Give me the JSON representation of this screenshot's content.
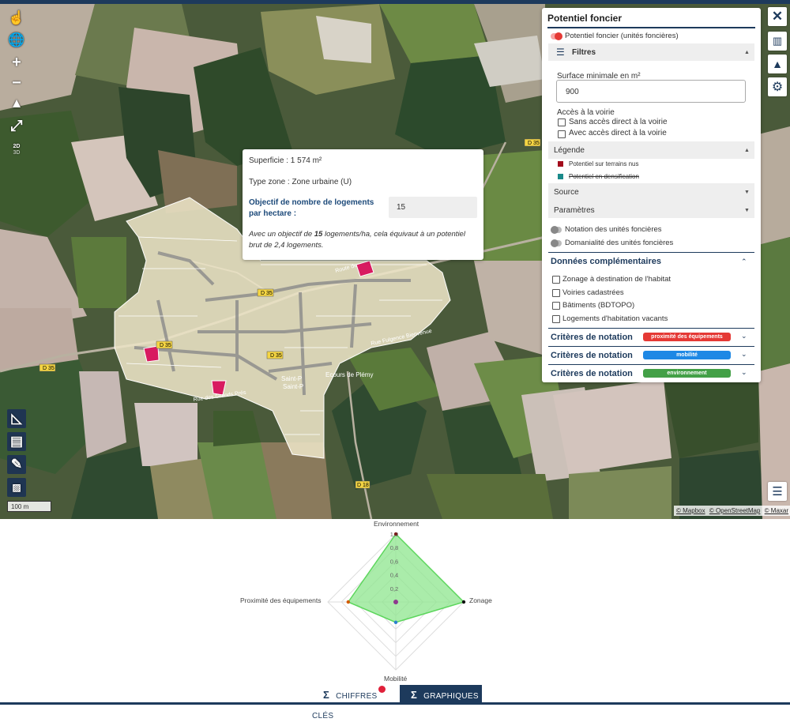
{
  "popup": {
    "superficie": "Superficie : 1 574 m²",
    "type_zone": "Type zone : Zone urbaine (U)",
    "objectif_label": "Objectif de nombre de logements par hectare :",
    "objectif_value": "15",
    "result_pre": "Avec un objectif de ",
    "result_bold": "15",
    "result_post": " logements/ha, cela équivaut à un potentiel brut de 2,4 logements."
  },
  "panel": {
    "title": "Potentiel foncier",
    "main_toggle": "Potentiel foncier (unités foncières)",
    "filtres": "Filtres",
    "surface_label": "Surface minimale en m²",
    "surface_value": "900",
    "acces_label": "Accès à la voirie",
    "sans_acces": "Sans accès direct à la voirie",
    "avec_acces": "Avec accès direct à la voirie",
    "legende": "Légende",
    "legend_items": [
      "Potentiel sur terrains nus",
      "Potentiel en densification"
    ],
    "source": "Source",
    "parametres": "Paramètres",
    "notation_toggle": "Notation des unités foncières",
    "domanialite_toggle": "Domanialité des unités foncières",
    "donnees_comp": "Données complémentaires",
    "comp_items": [
      "Zonage à destination de l'habitat",
      "Voiries cadastrées",
      "Bâtiments (BDTOPO)",
      "Logements d'habitation vacants"
    ],
    "criteres": [
      {
        "label": "Critères de notation",
        "badge": "proximité des équipements"
      },
      {
        "label": "Critères de notation",
        "badge": "mobilité"
      },
      {
        "label": "Critères de notation",
        "badge": "environnement"
      }
    ]
  },
  "map": {
    "road_labels": [
      "D 35",
      "D 35",
      "D 35",
      "D 35",
      "D 35",
      "D 18"
    ],
    "place_labels": [
      "Saint-P",
      "Saint-P",
      "Ecours de Plémy",
      "Rue des Grands Prés",
      "Route de",
      "Rue Fulgence Bienvenue"
    ],
    "scale": "100 m",
    "attribution": [
      "© Mapbox",
      "© OpenStreetMap",
      "© Maxar"
    ],
    "toggle_2d": "2D",
    "toggle_3d": "3D"
  },
  "tools_left": [
    "hand-pointer-icon",
    "globe-search-icon",
    "zoom-in-icon",
    "zoom-out-icon",
    "north-arrow-icon",
    "fullscreen-icon",
    "2d-3d-toggle",
    "measure-icon",
    "print-icon",
    "draw-icon",
    "basemap-icon"
  ],
  "tools_right": [
    "close-icon",
    "map-layers-icon",
    "shapes-icon",
    "settings-icon",
    "legend-list-icon"
  ],
  "chart_data": {
    "type": "radar",
    "axes": [
      "Environnement",
      "Zonage",
      "Mobilité",
      "Proximité des équipements"
    ],
    "ticks": [
      "1,0",
      "0,8",
      "0,6",
      "0,4",
      "0,2"
    ],
    "rmax": 1.0,
    "values": [
      1.0,
      1.0,
      0.3,
      0.7
    ],
    "colors": {
      "fill": "#8ee68e",
      "stroke": "#5cd65c",
      "points": [
        "#7a1e1e",
        "#111111",
        "#2a7fcf",
        "#d45a00"
      ]
    }
  },
  "tabs": {
    "chiffres": "CHIFFRES CLÉS",
    "graphiques": "GRAPHIQUES"
  },
  "colors": {
    "brand": "#1d3a5c",
    "red": "#e53935",
    "blue": "#1e88e5",
    "green": "#43a047"
  }
}
